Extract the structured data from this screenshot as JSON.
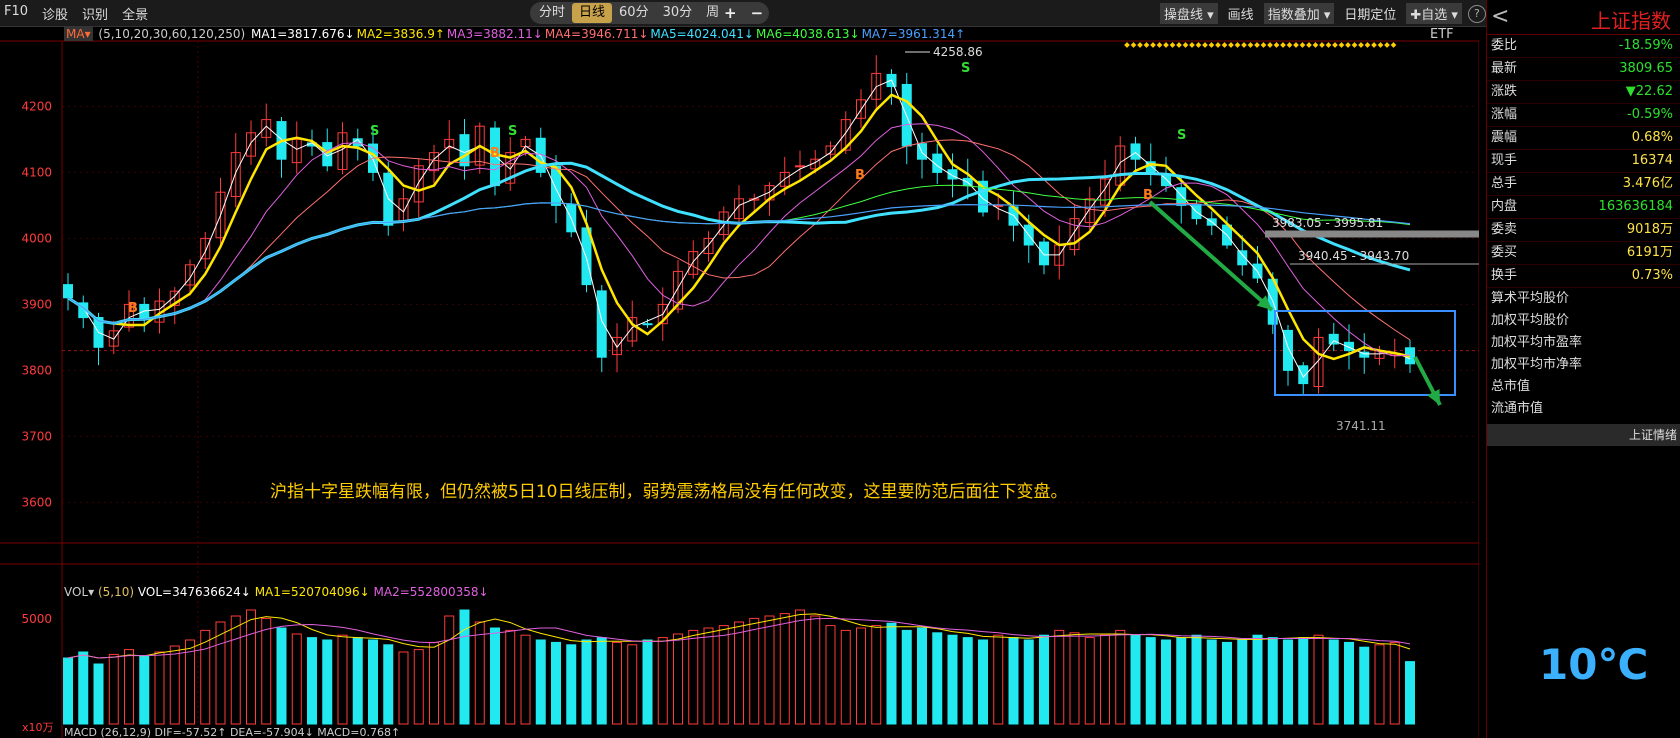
{
  "toolbar": {
    "left": [
      "F10",
      "诊股",
      "识别",
      "全景"
    ],
    "periods": [
      "分时",
      "日线",
      "60分",
      "30分",
      "周线 ▾"
    ],
    "active_period": "日线",
    "zoom_in": "+",
    "zoom_out": "−",
    "right": [
      "操盘线 ▾",
      "画线",
      "指数叠加 ▾",
      "日期定位",
      "✚自选 ▾"
    ],
    "help": "?"
  },
  "ma_legend": {
    "selector": "MA▾",
    "periods_label": "(5,10,20,30,60,120,250)",
    "items": [
      {
        "text": "MA1=3817.676↓",
        "color": "#ffffff"
      },
      {
        "text": "MA2=3836.9↑",
        "color": "#ffe600"
      },
      {
        "text": "MA3=3882.11↓",
        "color": "#e060e0"
      },
      {
        "text": "MA4=3946.711↓",
        "color": "#ff7070"
      },
      {
        "text": "MA5=4024.041↓",
        "color": "#40e0ff"
      },
      {
        "text": "MA6=4038.613↓",
        "color": "#40ff40"
      },
      {
        "text": "MA7=3961.314↑",
        "color": "#4aa0ff"
      }
    ],
    "etf": "ETF"
  },
  "annotations": {
    "high_label": "4258.86",
    "low_label": "3741.11",
    "gap1": "3983.05 - 3995.81",
    "gap2": "3940.45 - 3943.70",
    "comment": "沪指十字星跌幅有限，但仍然被5日10日线压制，弱势震荡格局没有任何改变，这里要防范后面往下变盘。",
    "signals": [
      {
        "text": "B",
        "color": "#ff7a1a"
      },
      {
        "text": "S",
        "color": "#33dd33"
      }
    ]
  },
  "vol_legend": {
    "selector": "VOL▾",
    "periods": "(5,10)",
    "vol": "VOL=347636624↓",
    "ma1": "MA1=520704096↓",
    "ma2": "MA2=552800358↓",
    "unit": "x10万",
    "tick": "5000"
  },
  "macd_legend": {
    "text": "MACD (26,12,9) DIF=-57.52↑ DEA=-57.904↓ MACD=0.768↑"
  },
  "panel": {
    "title": "上证指数",
    "back": "<",
    "stats": [
      {
        "k": "委比",
        "v": "-18.59%",
        "c": "green"
      },
      {
        "k": "最新",
        "v": "3809.65",
        "c": "green"
      },
      {
        "k": "涨跌",
        "v": "▼22.62",
        "c": "green"
      },
      {
        "k": "涨幅",
        "v": "-0.59%",
        "c": "green"
      },
      {
        "k": "震幅",
        "v": "0.68%",
        "c": "yellow"
      },
      {
        "k": "现手",
        "v": "16374",
        "c": "yellow"
      },
      {
        "k": "总手",
        "v": "3.476亿",
        "c": "yellow"
      },
      {
        "k": "内盘",
        "v": "163636184",
        "c": "green"
      },
      {
        "k": "委卖",
        "v": "9018万",
        "c": "yellow"
      },
      {
        "k": "委买",
        "v": "6191万",
        "c": "yellow"
      },
      {
        "k": "换手",
        "v": "0.73%",
        "c": "yellow"
      }
    ],
    "plain": [
      "算术平均股价",
      "加权平均股价",
      "加权平均市盈率",
      "加权平均市净率",
      "总市值",
      "流通市值"
    ],
    "qing": "上证情绪",
    "temp": "10℃"
  },
  "chart_data": {
    "type": "candlestick",
    "ylim": [
      3540,
      4290
    ],
    "yticks": [
      3600,
      3700,
      3800,
      3900,
      4000,
      4100,
      4200
    ],
    "ma_colors": {
      "ma5": "#ffffff",
      "ma10": "#ffe600",
      "ma20": "#e060e0",
      "ma30": "#ff7070",
      "ma60": "#40e0ff",
      "ma120": "#40ff40",
      "ma250": "#4aa0ff"
    },
    "anchors": [
      3910,
      3880,
      3835,
      3860,
      3900,
      3880,
      3905,
      3920,
      3960,
      4000,
      4070,
      4130,
      4160,
      4180,
      4120,
      4150,
      4140,
      4110,
      4160,
      4140,
      4100,
      4020,
      4060,
      4110,
      4130,
      4150,
      4110,
      4170,
      4080,
      4130,
      4150,
      4100,
      4050,
      4010,
      3930,
      3820,
      3850,
      3880,
      3870,
      3900,
      3950,
      3980,
      4000,
      4040,
      4060,
      4060,
      4080,
      4100,
      4110,
      4120,
      4140,
      4180,
      4210,
      4250,
      4230,
      4140,
      4120,
      4100,
      4090,
      4080,
      4040,
      4050,
      4020,
      3990,
      3960,
      3990,
      4030,
      4060,
      4090,
      4140,
      4120,
      4100,
      4080,
      4050,
      4030,
      4020,
      3990,
      3960,
      3940,
      3870,
      3800,
      3780,
      3850,
      3840,
      3830,
      3820,
      3830,
      3825,
      3810
    ],
    "volumes": [
      0.55,
      0.6,
      0.5,
      0.58,
      0.62,
      0.57,
      0.6,
      0.65,
      0.7,
      0.78,
      0.85,
      0.9,
      0.95,
      0.88,
      0.8,
      0.75,
      0.72,
      0.7,
      0.74,
      0.72,
      0.7,
      0.66,
      0.6,
      0.62,
      0.68,
      0.9,
      0.95,
      0.85,
      0.8,
      0.78,
      0.74,
      0.7,
      0.68,
      0.66,
      0.7,
      0.72,
      0.68,
      0.66,
      0.7,
      0.72,
      0.75,
      0.78,
      0.8,
      0.82,
      0.85,
      0.88,
      0.9,
      0.92,
      0.95,
      0.9,
      0.82,
      0.78,
      0.8,
      0.82,
      0.84,
      0.78,
      0.8,
      0.76,
      0.74,
      0.72,
      0.7,
      0.74,
      0.72,
      0.7,
      0.74,
      0.78,
      0.76,
      0.72,
      0.74,
      0.78,
      0.74,
      0.72,
      0.7,
      0.72,
      0.74,
      0.7,
      0.68,
      0.7,
      0.74,
      0.72,
      0.7,
      0.72,
      0.74,
      0.7,
      0.68,
      0.64,
      0.66,
      0.68,
      0.52
    ]
  }
}
